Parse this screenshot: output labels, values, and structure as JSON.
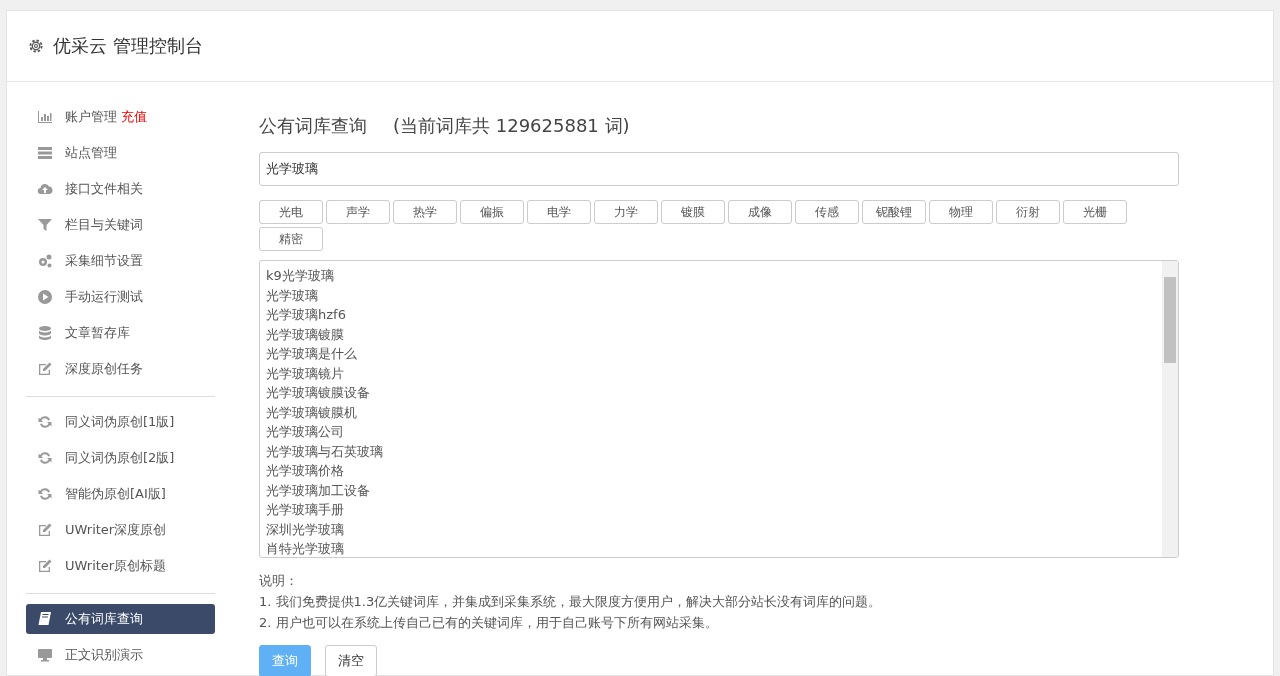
{
  "header": {
    "title": "优采云 管理控制台"
  },
  "sidebar": {
    "groups": [
      [
        {
          "label": "账户管理",
          "extra": "充值",
          "selected": false
        },
        {
          "label": "站点管理",
          "selected": false
        },
        {
          "label": "接口文件相关",
          "selected": false
        },
        {
          "label": "栏目与关键词",
          "selected": false
        },
        {
          "label": "采集细节设置",
          "selected": false
        },
        {
          "label": "手动运行测试",
          "selected": false
        },
        {
          "label": "文章暂存库",
          "selected": false
        },
        {
          "label": "深度原创任务",
          "selected": false
        }
      ],
      [
        {
          "label": "同义词伪原创[1版]",
          "selected": false
        },
        {
          "label": "同义词伪原创[2版]",
          "selected": false
        },
        {
          "label": "智能伪原创[AI版]",
          "selected": false
        },
        {
          "label": "UWriter深度原创",
          "selected": false
        },
        {
          "label": "UWriter原创标题",
          "selected": false
        }
      ],
      [
        {
          "label": "公有词库查询",
          "selected": true
        },
        {
          "label": "正文识别演示",
          "selected": false
        }
      ]
    ]
  },
  "main": {
    "title": "公有词库查询",
    "count_note": "(当前词库共 129625881 词)",
    "search": {
      "value": "光学玻璃"
    },
    "tags": [
      "光电",
      "声学",
      "热学",
      "偏振",
      "电学",
      "力学",
      "镀膜",
      "成像",
      "传感",
      "铌酸锂",
      "物理",
      "衍射",
      "光栅",
      "精密"
    ],
    "results": [
      "k9光学玻璃",
      "光学玻璃",
      "光学玻璃hzf6",
      "光学玻璃镀膜",
      "光学玻璃是什么",
      "光学玻璃镜片",
      "光学玻璃镀膜设备",
      "光学玻璃镀膜机",
      "光学玻璃公司",
      "光学玻璃与石英玻璃",
      "光学玻璃价格",
      "光学玻璃加工设备",
      "光学玻璃手册",
      "深圳光学玻璃",
      "肖特光学玻璃"
    ],
    "notes_title": "说明：",
    "notes": [
      "1. 我们免费提供1.3亿关键词库，并集成到采集系统，最大限度方便用户，解决大部分站长没有词库的问题。",
      "2. 用户也可以在系统上传自己已有的关键词库，用于自己账号下所有网站采集。"
    ],
    "buttons": [
      {
        "label": "查询",
        "kind": "primary"
      },
      {
        "label": "清空",
        "kind": "default"
      }
    ]
  }
}
